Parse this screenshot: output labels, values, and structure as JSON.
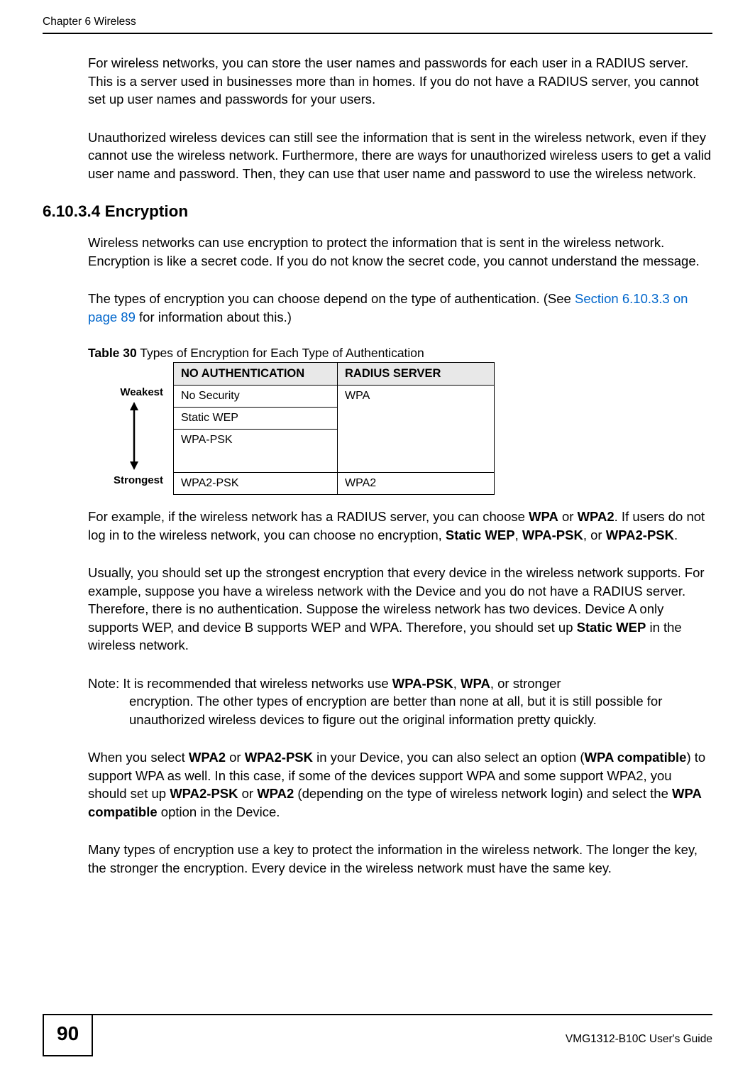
{
  "header": {
    "chapter": "Chapter 6 Wireless"
  },
  "paragraphs": {
    "p1": "For wireless networks, you can store the user names and passwords for each user in a RADIUS server. This is a server used in businesses more than in homes. If you do not have a RADIUS server, you cannot set up user names and passwords for your users.",
    "p2": "Unauthorized wireless devices can still see the information that is sent in the wireless network, even if they cannot use the wireless network. Furthermore, there are ways for unauthorized wireless users to get a valid user name and password. Then, they can use that user name and password to use the wireless network.",
    "section_heading": "6.10.3.4  Encryption",
    "p3": "Wireless networks can use encryption to protect the information that is sent in the wireless network. Encryption is like a secret code. If you do not know the secret code, you cannot understand the message.",
    "p4a": "The types of encryption you can choose depend on the type of authentication. (See ",
    "p4_link": "Section 6.10.3.3 on page 89",
    "p4b": " for information about this.)",
    "p5a": "For example, if the wireless network has a RADIUS server, you can choose ",
    "p5_wpa": "WPA",
    "p5b": " or ",
    "p5_wpa2": "WPA2",
    "p5c": ". If users do not log in to the wireless network, you can choose no encryption, ",
    "p5_swep": "Static WEP",
    "p5d": ", ",
    "p5_wpapsk": "WPA-PSK",
    "p5e": ", or ",
    "p5_wpa2psk": "WPA2-PSK",
    "p5f": ".",
    "p6a": "Usually, you should set up the strongest encryption that every device in the wireless network supports. For example, suppose you have a wireless network with the Device and you do not have a RADIUS server. Therefore, there is no authentication. Suppose the wireless network has two devices. Device A only supports WEP, and device B supports WEP and WPA. Therefore, you should set up ",
    "p6_swep": "Static WEP",
    "p6b": " in the wireless network.",
    "note_a": "Note: It is recommended that wireless networks use ",
    "note_wpapsk": "WPA-PSK",
    "note_b": ", ",
    "note_wpa": "WPA",
    "note_c": ", or stronger ",
    "note_rest": "encryption. The other types of encryption are better than none at all, but it is still possible for unauthorized wireless devices to figure out the original information pretty quickly.",
    "p8a": "When you select ",
    "p8_wpa2a": "WPA2",
    "p8b": " or ",
    "p8_wpa2psk": "WPA2-PSK",
    "p8c": " in your Device, you can also select an option (",
    "p8_wpacomp1": "WPA compatible",
    "p8d": ") to support WPA as well. In this case, if some of the devices support WPA and some support WPA2, you should set up ",
    "p8_wpa2pskb": "WPA2-PSK",
    "p8e": " or ",
    "p8_wpa2b": "WPA2",
    "p8f": " (depending on the type of wireless network login) and select the ",
    "p8_wpacomp2": "WPA compatible",
    "p8g": " option in the Device.",
    "p9": "Many types of encryption use a key to protect the information in the wireless network. The longer the key, the stronger the encryption. Every device in the wireless network must have the same key."
  },
  "table": {
    "caption_label": "Table 30",
    "caption_text": "   Types of Encryption for Each Type of Authentication",
    "header_na": "NO AUTHENTICATION",
    "header_rs": "RADIUS SERVER",
    "weakest_label": "Weakest",
    "strongest_label": "Strongest",
    "rows": {
      "r1c1": "No Security",
      "r1c2": "WPA",
      "r2c1": "Static WEP",
      "r3c1": "WPA-PSK",
      "r4c1": "WPA2-PSK",
      "r4c2": "WPA2"
    }
  },
  "footer": {
    "page_number": "90",
    "guide": "VMG1312-B10C User's Guide"
  }
}
